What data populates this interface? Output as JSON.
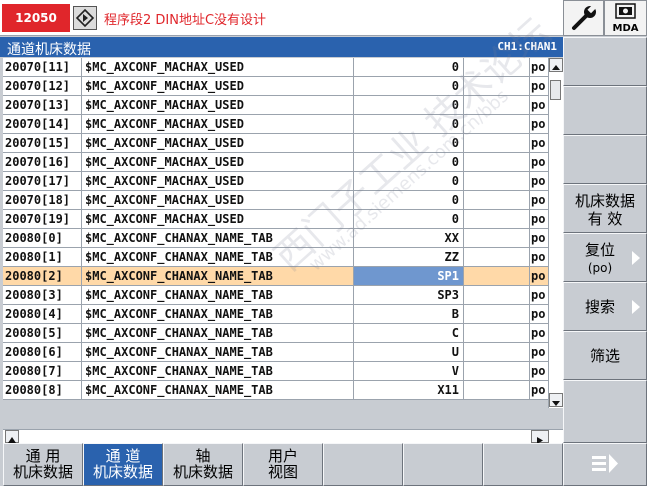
{
  "alarm": {
    "number": "12050",
    "message": "程序段2 DIN地址C没有设计"
  },
  "header_buttons": {
    "mda_label": "MDA"
  },
  "title": {
    "text": "通道机床数据",
    "channel": "CH1:CHAN1"
  },
  "table": {
    "rows": [
      {
        "id": "20070[11]",
        "name": "$MC_AXCONF_MACHAX_USED",
        "value": "0",
        "unit": "po"
      },
      {
        "id": "20070[12]",
        "name": "$MC_AXCONF_MACHAX_USED",
        "value": "0",
        "unit": "po"
      },
      {
        "id": "20070[13]",
        "name": "$MC_AXCONF_MACHAX_USED",
        "value": "0",
        "unit": "po"
      },
      {
        "id": "20070[14]",
        "name": "$MC_AXCONF_MACHAX_USED",
        "value": "0",
        "unit": "po"
      },
      {
        "id": "20070[15]",
        "name": "$MC_AXCONF_MACHAX_USED",
        "value": "0",
        "unit": "po"
      },
      {
        "id": "20070[16]",
        "name": "$MC_AXCONF_MACHAX_USED",
        "value": "0",
        "unit": "po"
      },
      {
        "id": "20070[17]",
        "name": "$MC_AXCONF_MACHAX_USED",
        "value": "0",
        "unit": "po"
      },
      {
        "id": "20070[18]",
        "name": "$MC_AXCONF_MACHAX_USED",
        "value": "0",
        "unit": "po"
      },
      {
        "id": "20070[19]",
        "name": "$MC_AXCONF_MACHAX_USED",
        "value": "0",
        "unit": "po"
      },
      {
        "id": "20080[0]",
        "name": "$MC_AXCONF_CHANAX_NAME_TAB",
        "value": "XX",
        "unit": "po"
      },
      {
        "id": "20080[1]",
        "name": "$MC_AXCONF_CHANAX_NAME_TAB",
        "value": "ZZ",
        "unit": "po"
      },
      {
        "id": "20080[2]",
        "name": "$MC_AXCONF_CHANAX_NAME_TAB",
        "value": "SP1",
        "unit": "po",
        "selected": true
      },
      {
        "id": "20080[3]",
        "name": "$MC_AXCONF_CHANAX_NAME_TAB",
        "value": "SP3",
        "unit": "po"
      },
      {
        "id": "20080[4]",
        "name": "$MC_AXCONF_CHANAX_NAME_TAB",
        "value": "B",
        "unit": "po"
      },
      {
        "id": "20080[5]",
        "name": "$MC_AXCONF_CHANAX_NAME_TAB",
        "value": "C",
        "unit": "po"
      },
      {
        "id": "20080[6]",
        "name": "$MC_AXCONF_CHANAX_NAME_TAB",
        "value": "U",
        "unit": "po"
      },
      {
        "id": "20080[7]",
        "name": "$MC_AXCONF_CHANAX_NAME_TAB",
        "value": "V",
        "unit": "po"
      },
      {
        "id": "20080[8]",
        "name": "$MC_AXCONF_CHANAX_NAME_TAB",
        "value": "X11",
        "unit": "po"
      }
    ]
  },
  "vertical_softkeys": [
    {
      "label": ""
    },
    {
      "label": ""
    },
    {
      "label": ""
    },
    {
      "label1": "机床数据",
      "label2": "有  效"
    },
    {
      "label1": "复位",
      "label2": "(po)",
      "arrow": true
    },
    {
      "label1": "搜索",
      "arrow": true
    },
    {
      "label1": "筛选"
    }
  ],
  "horizontal_softkeys": [
    {
      "line1": "通  用",
      "line2": "机床数据",
      "active": false
    },
    {
      "line1": "通  道",
      "line2": "机床数据",
      "active": true
    },
    {
      "line1": "轴",
      "line2": "机床数据",
      "active": false
    },
    {
      "line1": "用户",
      "line2": "视图",
      "active": false
    },
    {
      "line1": "",
      "line2": "",
      "active": false
    },
    {
      "line1": "",
      "line2": "",
      "active": false
    },
    {
      "line1": "",
      "line2": "",
      "active": false
    }
  ],
  "watermark": {
    "text": "西门子工业  技术论坛",
    "url": "www.ad.siemens.com.cn/bbs"
  },
  "colors": {
    "title_bar": "#2a62ae",
    "alarm_red": "#e0262b",
    "selected_row": "#ffd9a8",
    "selected_cell": "#6f97cf",
    "softkey": "#c8ccd2"
  }
}
